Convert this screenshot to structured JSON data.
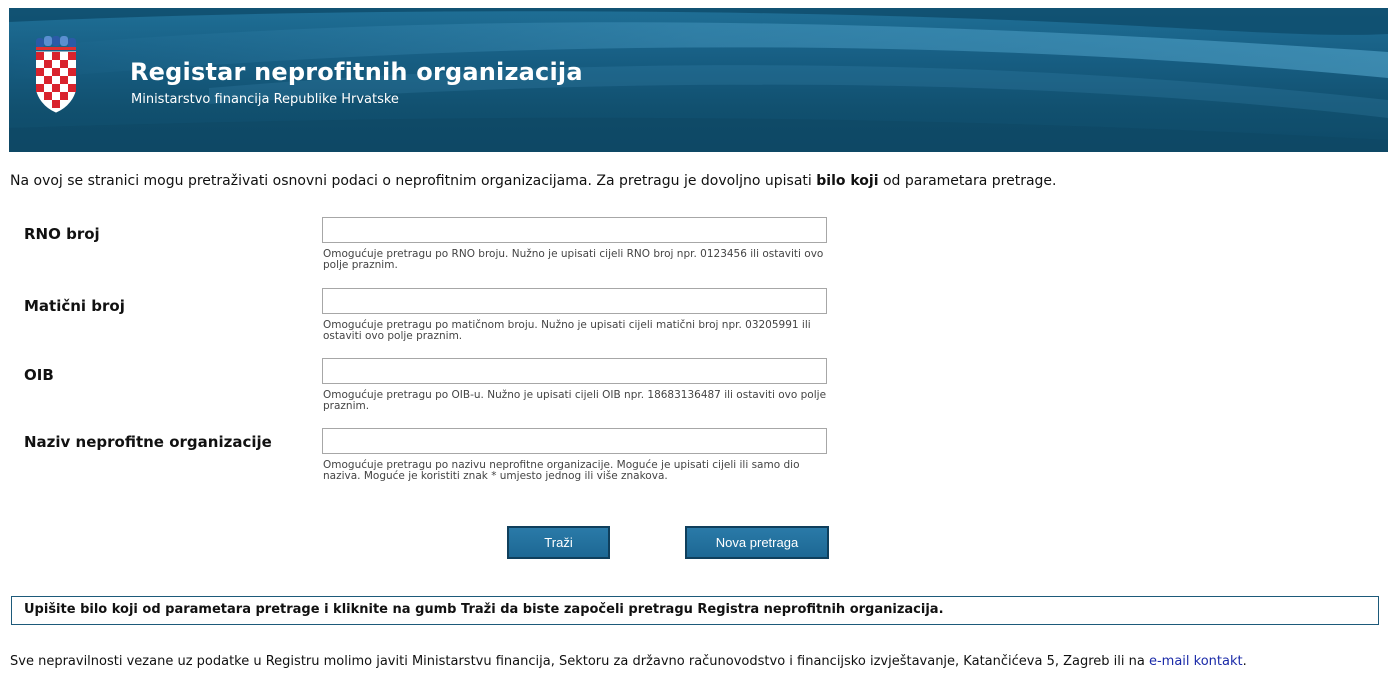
{
  "header": {
    "title": "Registar neprofitnih organizacija",
    "subtitle": "Ministarstvo financija Republike Hrvatske"
  },
  "intro": {
    "text_before": "Na ovoj se stranici mogu pretraživati osnovni podaci o neprofitnim organizacijama. Za pretragu je dovoljno upisati ",
    "text_bold": "bilo koji",
    "text_after": " od parametara pretrage."
  },
  "form": {
    "fields": [
      {
        "label": "RNO broj",
        "value": "",
        "help": "Omogućuje pretragu po RNO broju. Nužno je upisati cijeli RNO broj npr. 0123456 ili ostaviti ovo polje praznim."
      },
      {
        "label": "Matični broj",
        "value": "",
        "help": "Omogućuje pretragu po matičnom broju. Nužno je upisati cijeli matični broj npr. 03205991 ili ostaviti ovo polje praznim."
      },
      {
        "label": "OIB",
        "value": "",
        "help": "Omogućuje pretragu po OIB-u. Nužno je upisati cijeli OIB npr. 18683136487 ili ostaviti ovo polje praznim."
      },
      {
        "label": "Naziv neprofitne organizacije",
        "value": "",
        "help": "Omogućuje pretragu po nazivu neprofitne organizacije. Moguće je upisati cijeli ili samo dio naziva. Moguće je koristiti znak * umjesto jednog ili više znakova."
      }
    ],
    "search_button": "Traži",
    "new_search_button": "Nova pretraga"
  },
  "notice": "Upišite bilo koji od parametara pretrage i kliknite na gumb Traži da biste započeli pretragu Registra neprofitnih organizacija.",
  "footer": {
    "text": "Sve nepravilnosti vezane uz podatke u Registru molimo javiti Ministarstvu financija, Sektoru za državno računovodstvo i financijsko izvještavanje, Katančićeva 5, Zagreb ili na ",
    "link_text": "e-mail kontakt",
    "after_link": "."
  },
  "colors": {
    "header_bg": "#175e83",
    "button_bg": "#1d6894",
    "notice_border": "#1d5a7a",
    "link": "#1a2aa8"
  },
  "icons": {
    "crest": "croatian-coat-of-arms-icon"
  }
}
